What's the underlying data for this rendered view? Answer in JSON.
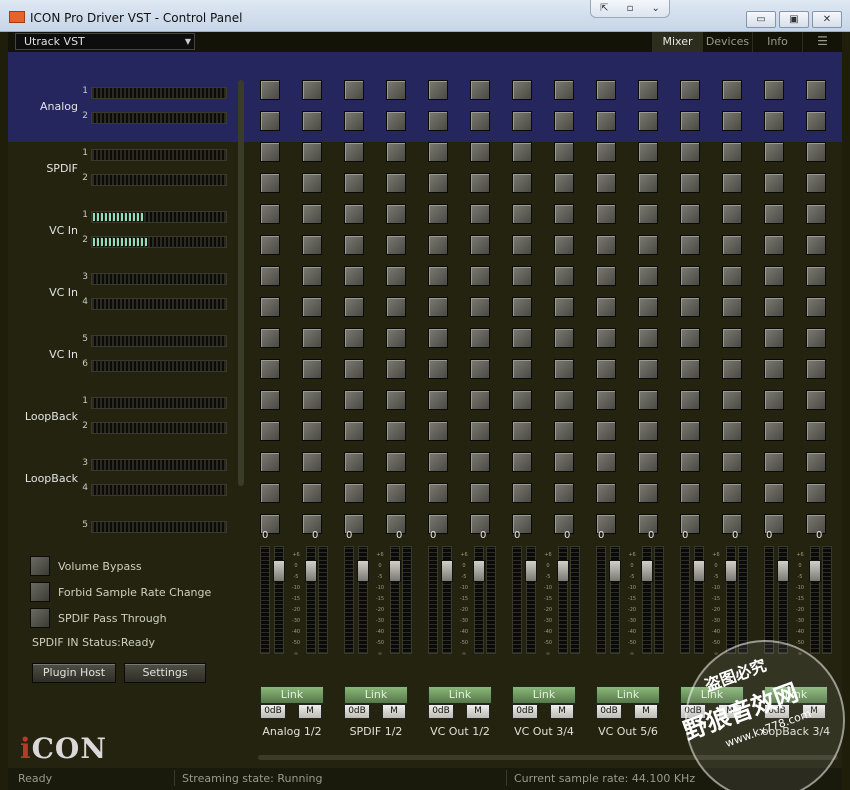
{
  "window": {
    "title": "ICON Pro Driver VST - Control Panel",
    "snap_icons": [
      "restore-arrows",
      "pin",
      "chevron-down"
    ]
  },
  "toolbar": {
    "device": "Utrack VST",
    "tabs": [
      "Mixer",
      "Devices",
      "Info",
      "☰"
    ],
    "active_tab": "Mixer"
  },
  "inputs": [
    {
      "label": "Analog",
      "channels": [
        "1",
        "2"
      ],
      "levels": [
        0,
        0
      ]
    },
    {
      "label": "SPDIF",
      "channels": [
        "1",
        "2"
      ],
      "levels": [
        0,
        0
      ]
    },
    {
      "label": "VC In",
      "channels": [
        "1",
        "2"
      ],
      "levels": [
        0.38,
        0.4
      ]
    },
    {
      "label": "VC In",
      "channels": [
        "3",
        "4"
      ],
      "levels": [
        0,
        0
      ]
    },
    {
      "label": "VC In",
      "channels": [
        "5",
        "6"
      ],
      "levels": [
        0,
        0
      ]
    },
    {
      "label": "LoopBack",
      "channels": [
        "1",
        "2"
      ],
      "levels": [
        0,
        0
      ]
    },
    {
      "label": "LoopBack",
      "channels": [
        "3",
        "4"
      ],
      "levels": [
        0,
        0
      ]
    },
    {
      "label": "",
      "channels": [
        "5"
      ],
      "levels": [
        0
      ]
    }
  ],
  "options": [
    {
      "label": "Volume Bypass"
    },
    {
      "label": "Forbid Sample Rate Change"
    },
    {
      "label": "SPDIF Pass Through"
    }
  ],
  "spdif_status": "SPDIF IN Status:Ready",
  "buttons": {
    "plugin_host": "Plugin Host",
    "settings": "Settings"
  },
  "logo": {
    "first": "i",
    "rest": "CON"
  },
  "strips": [
    {
      "label": "Analog 1/2",
      "left_db": "0",
      "right_db": "0"
    },
    {
      "label": "SPDIF 1/2",
      "left_db": "0",
      "right_db": "0"
    },
    {
      "label": "VC Out 1/2",
      "left_db": "0",
      "right_db": "0"
    },
    {
      "label": "VC Out 3/4",
      "left_db": "0",
      "right_db": "0"
    },
    {
      "label": "VC Out 5/6",
      "left_db": "0",
      "right_db": "0"
    },
    {
      "label": "",
      "left_db": "0",
      "right_db": "0"
    },
    {
      "label": "oopBack 3/4",
      "left_db": "0",
      "right_db": "0"
    }
  ],
  "strip_controls": {
    "link": "Link",
    "zero_db": "0dB",
    "mute": "M"
  },
  "fader_scale": [
    "+6",
    "0",
    "-5",
    "-10",
    "-15",
    "-20",
    "-30",
    "-40",
    "-50",
    "∞"
  ],
  "statusbar": {
    "state": "Ready",
    "streaming": "Streaming state: Running",
    "sample_rate": "Current sample rate: 44.100 KHz"
  },
  "watermark": {
    "line1": "盗图必究",
    "line2": "野狼音效网",
    "line3": "www.kx778.com"
  }
}
